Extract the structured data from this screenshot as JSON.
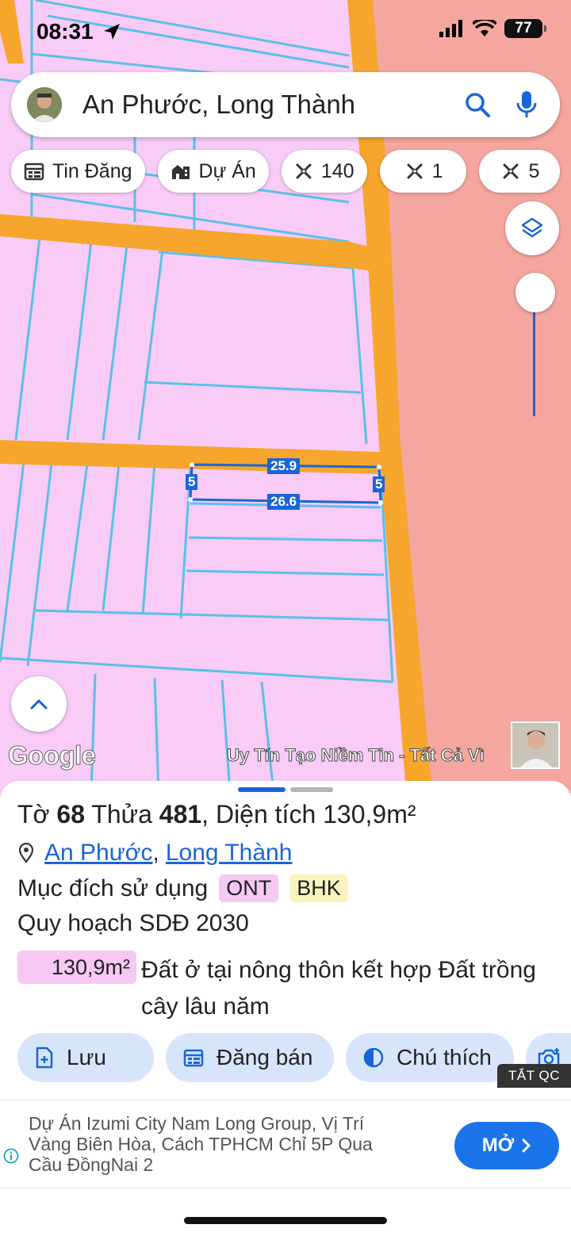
{
  "status": {
    "time": "08:31",
    "battery": "77"
  },
  "search": {
    "query": "An Phước, Long Thành"
  },
  "chips": [
    {
      "label": "Tin Đăng",
      "icon": "calendar-icon"
    },
    {
      "label": "Dự Án",
      "icon": "building-icon"
    },
    {
      "label": "140",
      "icon": "measure-icon"
    },
    {
      "label": "1",
      "icon": "measure-icon"
    },
    {
      "label": "5",
      "icon": "measure-icon"
    }
  ],
  "map": {
    "plot_top_length": "25.9",
    "plot_bottom_length": "26.6",
    "plot_left_side": "5",
    "plot_right_side": "5",
    "attribution": "Google",
    "watermark": "Uy Tín Tạo Niềm Tin - Tất Cả Vì",
    "colors": {
      "rural_residential": "#f9cbf7",
      "road": "#f6a62c",
      "urban": "#f5a79f",
      "parcel_line": "#5bc0e8",
      "highlight": "#1a65d6"
    }
  },
  "parcel": {
    "sheet_label": "Tờ",
    "sheet_no": "68",
    "lot_label": "Thửa",
    "lot_no": "481",
    "area_label": "Diện tích",
    "area": "130,9m²",
    "ward": "An Phước",
    "district": "Long Thành",
    "purpose_label": "Mục đích sử dụng",
    "purpose_tags": [
      "ONT",
      "BHK"
    ],
    "plan_label": "Quy hoạch SDĐ 2030",
    "plan_area": "130,9m²",
    "plan_desc": "Đất ở tại nông thôn kết hợp Đất trồng cây lâu năm"
  },
  "actions": [
    {
      "label": "Lưu",
      "icon": "add-doc-icon"
    },
    {
      "label": "Đăng bán",
      "icon": "calendar-icon"
    },
    {
      "label": "Chú thích",
      "icon": "contrast-icon"
    },
    {
      "label": "",
      "icon": "camera-icon"
    }
  ],
  "ad": {
    "corner_label": "TẮT QC",
    "text": "Dự Án Izumi City Nam Long Group, Vị Trí Vàng Biên Hòa, Cách TPHCM Chỉ 5P Qua Cầu ĐồngNai 2",
    "button": "MỞ"
  }
}
